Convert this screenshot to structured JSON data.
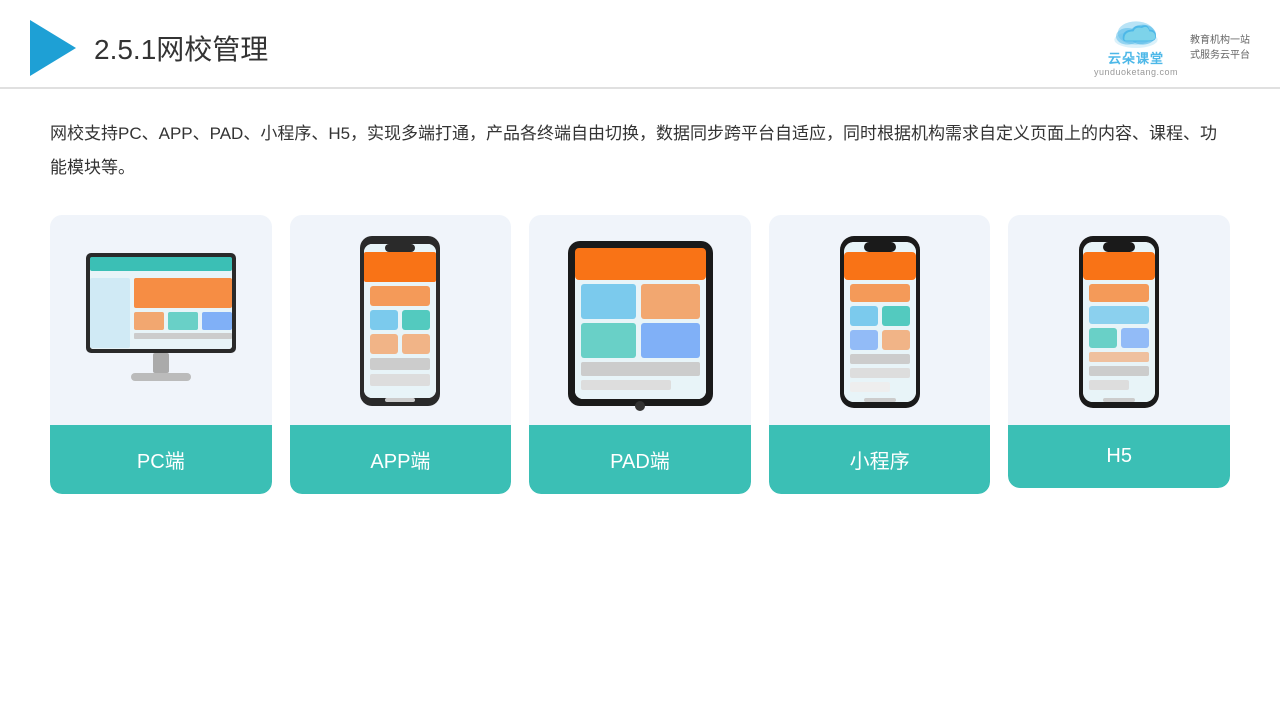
{
  "header": {
    "title_prefix": "2.5.1",
    "title_main": "网校管理",
    "logo": {
      "name": "云朵课堂",
      "pinyin": "yunduoketang.com",
      "slogan_line1": "教育机构一站",
      "slogan_line2": "式服务云平台"
    }
  },
  "description": "网校支持PC、APP、PAD、小程序、H5，实现多端打通，产品各终端自由切换，数据同步跨平台自适应，同时根据机构需求自定义页面上的内容、课程、功能模块等。",
  "cards": [
    {
      "id": "pc",
      "label": "PC端"
    },
    {
      "id": "app",
      "label": "APP端"
    },
    {
      "id": "pad",
      "label": "PAD端"
    },
    {
      "id": "mini",
      "label": "小程序"
    },
    {
      "id": "h5",
      "label": "H5"
    }
  ]
}
